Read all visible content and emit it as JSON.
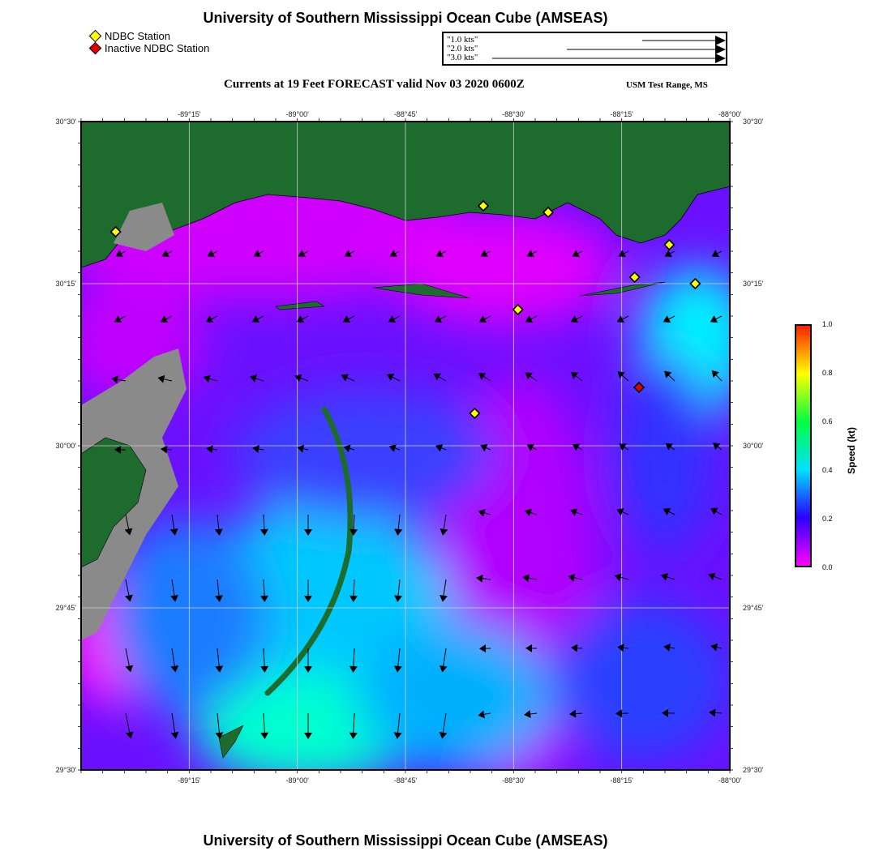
{
  "header": {
    "title": "University of Southern Mississippi Ocean Cube (AMSEAS)",
    "subtitle": "Currents at 19 Feet FORECAST valid Nov 03 2020 0600Z",
    "range_label": "USM Test Range, MS"
  },
  "footer": {
    "title": "University of Southern Mississippi Ocean Cube (AMSEAS)"
  },
  "legend": {
    "items": [
      {
        "label": "NDBC Station",
        "color": "#ffff00"
      },
      {
        "label": "Inactive NDBC Station",
        "color": "#e00000"
      }
    ]
  },
  "reference_arrows": [
    {
      "label": "1.0 kts",
      "length_kts": 1.0
    },
    {
      "label": "2.0 kts",
      "length_kts": 2.0
    },
    {
      "label": "3.0 kts",
      "length_kts": 3.0
    }
  ],
  "map": {
    "lon_range": [
      -89.5,
      -88.0
    ],
    "lat_range": [
      29.5,
      30.5
    ],
    "lon_ticks": [
      "-89°15'",
      "-89°00'",
      "-88°45'",
      "-88°30'",
      "-88°15'",
      "-88°00'"
    ],
    "lon_tick_values": [
      -89.25,
      -89.0,
      -88.75,
      -88.5,
      -88.25,
      -88.0
    ],
    "lat_ticks": [
      "30°30'",
      "30°15'",
      "30°00'",
      "29°45'",
      "29°30'"
    ],
    "lat_tick_values": [
      30.5,
      30.25,
      30.0,
      29.75,
      29.5
    ],
    "colors": {
      "land": "#1e6b2e",
      "marsh": "#8a8a8a",
      "grid": "#cfcfcf"
    },
    "stations": [
      {
        "lon": -89.42,
        "lat": 30.33,
        "status": "active"
      },
      {
        "lon": -88.57,
        "lat": 30.37,
        "status": "active"
      },
      {
        "lon": -88.42,
        "lat": 30.36,
        "status": "active"
      },
      {
        "lon": -88.14,
        "lat": 30.31,
        "status": "active"
      },
      {
        "lon": -88.22,
        "lat": 30.26,
        "status": "active"
      },
      {
        "lon": -88.08,
        "lat": 30.25,
        "status": "active"
      },
      {
        "lon": -88.49,
        "lat": 30.21,
        "status": "active"
      },
      {
        "lon": -88.59,
        "lat": 30.05,
        "status": "active"
      },
      {
        "lon": -88.21,
        "lat": 30.09,
        "status": "inactive"
      }
    ]
  },
  "colorbar": {
    "label": "Speed (kt)",
    "ticks": [
      "1.0",
      "0.8",
      "0.6",
      "0.4",
      "0.2",
      "0.0"
    ],
    "range": [
      0.0,
      1.0
    ],
    "gradient": [
      "#ff00ff",
      "#2a00ff",
      "#00e0ff",
      "#00ff40",
      "#ffff00",
      "#ff2000"
    ]
  }
}
